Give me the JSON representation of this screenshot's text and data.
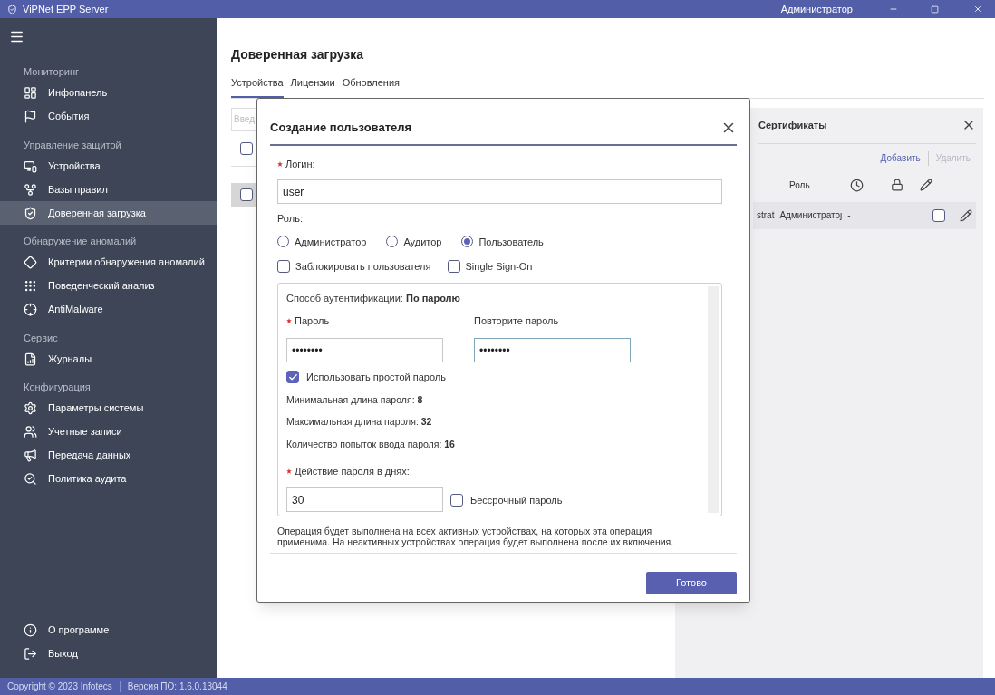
{
  "window": {
    "title": "ViPNet EPP Server",
    "user": "Администратор"
  },
  "sidebar": {
    "sections": [
      {
        "label": "Мониторинг",
        "items": [
          {
            "label": "Инфопанель",
            "selected": false
          },
          {
            "label": "События",
            "selected": false
          }
        ]
      },
      {
        "label": "Управление защитой",
        "items": [
          {
            "label": "Устройства",
            "selected": false
          },
          {
            "label": "Базы правил",
            "selected": false
          },
          {
            "label": "Доверенная загрузка",
            "selected": true
          }
        ]
      },
      {
        "label": "Обнаружение аномалий",
        "items": [
          {
            "label": "Критерии обнаружения аномалий",
            "selected": false
          },
          {
            "label": "Поведенческий анализ",
            "selected": false
          },
          {
            "label": "AntiMalware",
            "selected": false
          }
        ]
      },
      {
        "label": "Сервис",
        "items": [
          {
            "label": "Журналы",
            "selected": false
          }
        ]
      },
      {
        "label": "Конфигурация",
        "items": [
          {
            "label": "Параметры системы",
            "selected": false
          },
          {
            "label": "Учетные записи",
            "selected": false
          },
          {
            "label": "Передача данных",
            "selected": false
          },
          {
            "label": "Политика аудита",
            "selected": false
          }
        ]
      }
    ],
    "bottom_items": [
      {
        "label": "О программе",
        "selected": false
      },
      {
        "label": "Выход",
        "selected": false
      }
    ]
  },
  "page": {
    "title": "Доверенная загрузка",
    "tabs": [
      {
        "label": "Устройства",
        "selected": true
      },
      {
        "label": "Лицензии",
        "selected": false
      },
      {
        "label": "Обновления",
        "selected": false
      }
    ],
    "search": {
      "placeholder": "Введ"
    },
    "header_checked": false,
    "rows": [
      {
        "checked": false,
        "selected": true
      }
    ]
  },
  "certificates_panel": {
    "title": "Сертификаты",
    "actions": [
      {
        "label": "Добавить",
        "disabled": false
      },
      {
        "label": "Удалить",
        "disabled": true
      }
    ],
    "role_header": "Роль",
    "rows": [
      {
        "cells": [
          "strat",
          "Администратоȷ",
          "-"
        ],
        "locked": false
      }
    ]
  },
  "dialog": {
    "title": "Создание пользователя",
    "login": {
      "label": "Логин:",
      "required": true,
      "value": "user"
    },
    "role": {
      "label": "Роль:",
      "options": [
        {
          "label": "Администратор",
          "selected": false
        },
        {
          "label": "Аудитор",
          "selected": false
        },
        {
          "label": "Пользователь",
          "selected": true
        }
      ]
    },
    "flags": [
      {
        "label": "Заблокировать пользователя",
        "checked": false
      },
      {
        "label": "Single Sign-On",
        "checked": false
      }
    ],
    "auth": {
      "label": "Способ аутентификации:",
      "value": "По паролю",
      "password": {
        "label": "Пароль",
        "required": true,
        "value": "••••••••"
      },
      "repeat": {
        "label": "Повторите пароль",
        "required": false,
        "value": "••••••••"
      },
      "simple": {
        "label": "Использовать простой пароль",
        "checked": true
      },
      "facts": [
        {
          "label": "Минимальная длина пароля:",
          "value": "8"
        },
        {
          "label": "Максимальная длина пароля:",
          "value": "32"
        },
        {
          "label": "Количество попыток ввода пароля:",
          "value": "16"
        }
      ],
      "validity": {
        "label": "Действие пароля в днях:",
        "required": true,
        "value": "30"
      },
      "unlimited": {
        "label": "Бессрочный пароль",
        "checked": false
      }
    },
    "note": "Операция будет выполнена на всех активных устройствах, на которых эта операция применима. На неактивных устройствах операция будет выполнена после их включения.",
    "submit": "Готово"
  },
  "status_bar": {
    "copyright": "Copyright © 2023 Infotecs",
    "version": "Версия ПО: 1.6.0.13044"
  }
}
